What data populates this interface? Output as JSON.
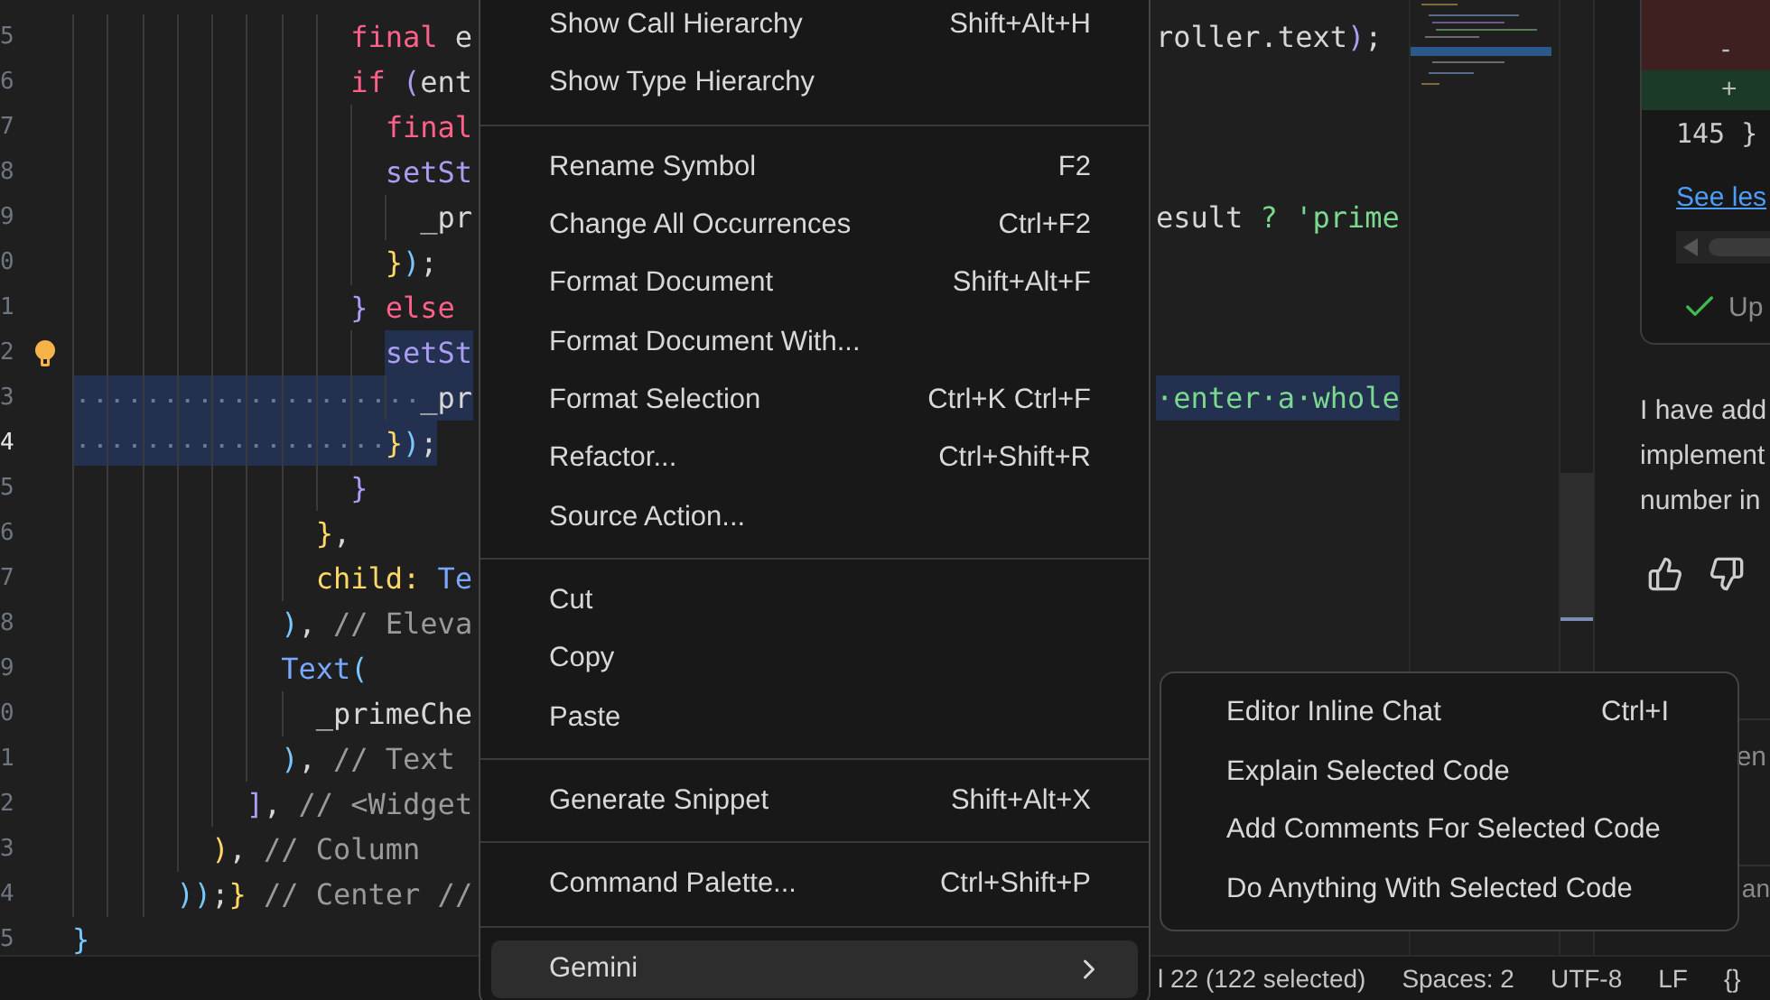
{
  "editor": {
    "lines": [
      {
        "children": [
          {
            "children": [
              {
                "children": [
                  {
                    "children": [
                      {
                        "children": [
                          {
                            "children": [
                              {
                                "children": [
                                  {
                                    "children": [
                                      {
                                        "number": "5",
                                        "tokens": [
                                          {
                                            "text": "final",
                                            "kind": "keyword"
                                          },
                                          {
                                            "text": " e",
                                            "kind": "plain"
                                          }
                                        ],
                                        "right": [
                                          {
                                            "text": "roller.text",
                                            "kind": "plain"
                                          },
                                          {
                                            "text": ")",
                                            "kind": "paren"
                                          },
                                          {
                                            "text": ";",
                                            "kind": "plain"
                                          }
                                        ],
                                        "selected": false,
                                        "current": false,
                                        "lightbulb": false
                                      },
                                      {
                                        "number": "6",
                                        "tokens": [
                                          {
                                            "text": "if",
                                            "kind": "keyword"
                                          },
                                          {
                                            "text": " (",
                                            "kind": "paren"
                                          },
                                          {
                                            "text": "ent",
                                            "kind": "plain"
                                          }
                                        ],
                                        "selected": false,
                                        "current": false,
                                        "lightbulb": false,
                                        "children": [
                                          {
                                            "number": "7",
                                            "tokens": [
                                              {
                                                "text": "final",
                                                "kind": "keyword"
                                              }
                                            ],
                                            "selected": false,
                                            "current": false,
                                            "lightbulb": false
                                          },
                                          {
                                            "number": "8",
                                            "tokens": [
                                              {
                                                "text": "setSt",
                                                "kind": "function"
                                              }
                                            ],
                                            "selected": false,
                                            "current": false,
                                            "lightbulb": false,
                                            "children": [
                                              {
                                                "number": "9",
                                                "tokens": [
                                                  {
                                                    "text": "_pr",
                                                    "kind": "plain"
                                                  }
                                                ],
                                                "right": [
                                                  {
                                                    "text": "esult ",
                                                    "kind": "plain"
                                                  },
                                                  {
                                                    "text": "? 'prime",
                                                    "kind": "string"
                                                  }
                                                ],
                                                "selected": false,
                                                "current": false,
                                                "lightbulb": false
                                              }
                                            ]
                                          },
                                          {
                                            "number": "0",
                                            "tokens": [
                                              {
                                                "text": "}",
                                                "kind": "brace"
                                              },
                                              {
                                                "text": ")",
                                                "kind": "bracket"
                                              },
                                              {
                                                "text": ";",
                                                "kind": "plain"
                                              }
                                            ],
                                            "selected": false,
                                            "current": false,
                                            "lightbulb": false
                                          }
                                        ]
                                      },
                                      {
                                        "number": "1",
                                        "tokens": [
                                          {
                                            "text": "}",
                                            "kind": "paren"
                                          },
                                          {
                                            "text": " else",
                                            "kind": "keyword"
                                          }
                                        ],
                                        "selected": false,
                                        "current": false,
                                        "lightbulb": false,
                                        "children": [
                                          {
                                            "number": "2",
                                            "tokens": [
                                              {
                                                "text": "setSt",
                                                "kind": "function"
                                              }
                                            ],
                                            "selected": true,
                                            "current": false,
                                            "lightbulb": true,
                                            "children": [
                                              {
                                                "number": "3",
                                                "tokens": [
                                                  {
                                                    "text": "_pr",
                                                    "kind": "plain"
                                                  }
                                                ],
                                                "right": [
                                                  {
                                                    "text": "·enter·a·whole",
                                                    "kind": "string"
                                                  }
                                                ],
                                                "selected": true,
                                                "current": false,
                                                "lightbulb": false
                                              }
                                            ]
                                          },
                                          {
                                            "number": "4",
                                            "tokens": [
                                              {
                                                "text": "}",
                                                "kind": "brace"
                                              },
                                              {
                                                "text": ")",
                                                "kind": "bracket"
                                              },
                                              {
                                                "text": ";",
                                                "kind": "plain"
                                              }
                                            ],
                                            "selected": true,
                                            "current": true,
                                            "lightbulb": false
                                          }
                                        ]
                                      },
                                      {
                                        "number": "5",
                                        "tokens": [
                                          {
                                            "text": "}",
                                            "kind": "paren"
                                          }
                                        ],
                                        "selected": false,
                                        "current": false,
                                        "lightbulb": false
                                      }
                                    ]
                                  },
                                  {
                                    "number": "6",
                                    "tokens": [
                                      {
                                        "text": "}",
                                        "kind": "brace"
                                      },
                                      {
                                        "text": ",",
                                        "kind": "plain"
                                      }
                                    ],
                                    "selected": false,
                                    "current": false,
                                    "lightbulb": false
                                  },
                                  {
                                    "number": "7",
                                    "tokens": [
                                      {
                                        "text": "child:",
                                        "kind": "brace"
                                      },
                                      {
                                        "text": " Te",
                                        "kind": "type"
                                      }
                                    ],
                                    "selected": false,
                                    "current": false,
                                    "lightbulb": false
                                  }
                                ]
                              },
                              {
                                "number": "8",
                                "tokens": [
                                  {
                                    "text": ")",
                                    "kind": "bracket"
                                  },
                                  {
                                    "text": ",",
                                    "kind": "plain"
                                  },
                                  {
                                    "text": " // Eleva",
                                    "kind": "comment"
                                  }
                                ],
                                "selected": false,
                                "current": false,
                                "lightbulb": false
                              },
                              {
                                "number": "9",
                                "tokens": [
                                  {
                                    "text": "Text",
                                    "kind": "type"
                                  },
                                  {
                                    "text": "(",
                                    "kind": "bracket"
                                  }
                                ],
                                "selected": false,
                                "current": false,
                                "lightbulb": false,
                                "children": [
                                  {
                                    "number": "0",
                                    "tokens": [
                                      {
                                        "text": "_primeChe",
                                        "kind": "plain"
                                      }
                                    ],
                                    "selected": false,
                                    "current": false,
                                    "lightbulb": false
                                  }
                                ]
                              },
                              {
                                "number": "1",
                                "tokens": [
                                  {
                                    "text": ")",
                                    "kind": "bracket"
                                  },
                                  {
                                    "text": ",",
                                    "kind": "plain"
                                  },
                                  {
                                    "text": " // Text",
                                    "kind": "comment"
                                  }
                                ],
                                "selected": false,
                                "current": false,
                                "lightbulb": false
                              }
                            ]
                          },
                          {
                            "number": "2",
                            "tokens": [
                              {
                                "text": "]",
                                "kind": "paren"
                              },
                              {
                                "text": ",",
                                "kind": "plain"
                              },
                              {
                                "text": " // <Widget",
                                "kind": "comment"
                              }
                            ],
                            "selected": false,
                            "current": false,
                            "lightbulb": false
                          }
                        ]
                      },
                      {
                        "number": "3",
                        "tokens": [
                          {
                            "text": ")",
                            "kind": "brace"
                          },
                          {
                            "text": ",",
                            "kind": "plain"
                          },
                          {
                            "text": " // Column",
                            "kind": "comment"
                          }
                        ],
                        "selected": false,
                        "current": false,
                        "lightbulb": false
                      }
                    ]
                  },
                  {
                    "number": "4",
                    "tokens": [
                      {
                        "text": "))",
                        "kind": "bracket"
                      },
                      {
                        "text": ";",
                        "kind": "plain"
                      },
                      {
                        "text": "}",
                        "kind": "brace"
                      },
                      {
                        "text": " // Center //",
                        "kind": "comment"
                      }
                    ],
                    "selected": false,
                    "current": false,
                    "lightbulb": false
                  }
                ]
              }
            ]
          }
        ]
      },
      {
        "number": "5",
        "tokens": [
          {
            "text": "}",
            "kind": "bracket"
          }
        ],
        "selected": false,
        "current": false,
        "lightbulb": false
      }
    ]
  },
  "context_menu": {
    "groups": [
      [
        {
          "label": "Show Call Hierarchy",
          "shortcut": "Shift+Alt+H"
        },
        {
          "label": "Show Type Hierarchy"
        }
      ],
      [
        {
          "label": "Rename Symbol",
          "shortcut": "F2"
        },
        {
          "label": "Change All Occurrences",
          "shortcut": "Ctrl+F2"
        },
        {
          "label": "Format Document",
          "shortcut": "Shift+Alt+F"
        },
        {
          "label": "Format Document With..."
        },
        {
          "label": "Format Selection",
          "shortcut": "Ctrl+K Ctrl+F"
        },
        {
          "label": "Refactor...",
          "shortcut": "Ctrl+Shift+R"
        },
        {
          "label": "Source Action..."
        }
      ],
      [
        {
          "label": "Cut"
        },
        {
          "label": "Copy"
        },
        {
          "label": "Paste"
        }
      ],
      [
        {
          "label": "Generate Snippet",
          "shortcut": "Shift+Alt+X"
        }
      ],
      [
        {
          "label": "Command Palette...",
          "shortcut": "Ctrl+Shift+P"
        }
      ],
      [
        {
          "label": "Gemini",
          "submenu": true,
          "selected": true
        }
      ]
    ]
  },
  "submenu": {
    "items": [
      {
        "label": "Editor Inline Chat",
        "shortcut": "Ctrl+I"
      },
      {
        "label": "Explain Selected Code"
      },
      {
        "label": "Add Comments For Selected Code"
      },
      {
        "label": "Do Anything With Selected Code"
      }
    ]
  },
  "chat": {
    "diff_rows": [
      {
        "sign": "-",
        "kind": "removed"
      },
      {
        "sign": "+",
        "kind": "added"
      }
    ],
    "code_line": "145 }",
    "link": "See les",
    "status": "Up",
    "message": [
      "I have add",
      "implement",
      "number in"
    ],
    "input_hint": "en",
    "footer_text": "an"
  },
  "status_bar": {
    "items": [
      "l 22 (122 selected)",
      "Spaces: 2",
      "UTF-8",
      "LF",
      "{}"
    ]
  }
}
